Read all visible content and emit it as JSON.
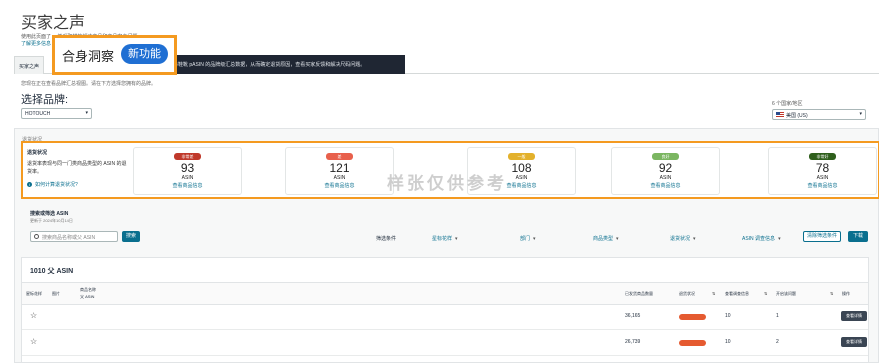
{
  "page": {
    "title": "买家之声"
  },
  "intro": {
    "line1": "使用此页面了                                                    ，并采取措施解决商品和商品客户问题。",
    "link": "了解更多信息"
  },
  "tabs": [
    {
      "label": "买家之声"
    },
    {
      "label": "合"
    }
  ],
  "feature": {
    "name": "合身洞察",
    "badge": "新功能"
  },
  "tooltip": {
    "text": "以查看服装与鞋靴 pASIN 的品牌级汇总数据，从而确定退货原因，查看买家反馈和解决尺码问题。"
  },
  "brand": {
    "note": "您现在正在查看品牌汇总视图。请在下方选择您拥有的品牌。",
    "label": "选择品牌:",
    "selected": "HOTOUCH"
  },
  "marketplace": {
    "label": "6 个国家/地区",
    "selected": "美国 (US)"
  },
  "ghost_row": "退货状况",
  "status_panel": {
    "heading": "退货状况",
    "text": "退货率表现与同一门类商品类型的 ASIN 的退货率。",
    "link": "如何计算退货状况?",
    "cards": [
      {
        "label": "非常差",
        "value": "93",
        "unit": "ASIN",
        "link": "查看商品信息",
        "color": "#c0392b"
      },
      {
        "label": "差",
        "value": "121",
        "unit": "ASIN",
        "link": "查看商品信息",
        "color": "#e8604c"
      },
      {
        "label": "一般",
        "value": "108",
        "unit": "ASIN",
        "link": "查看商品信息",
        "color": "#e3b12c"
      },
      {
        "label": "良好",
        "value": "92",
        "unit": "ASIN",
        "link": "查看商品信息",
        "color": "#7bb661"
      },
      {
        "label": "非常好",
        "value": "78",
        "unit": "ASIN",
        "link": "查看商品信息",
        "color": "#2f5f1c"
      }
    ]
  },
  "watermark": "样张仅供参考",
  "search": {
    "heading": "搜索或筛选 ASIN",
    "updated": "更新于 2024年10月14日",
    "placeholder": "搜索商品名称或父 ASIN",
    "button": "搜索"
  },
  "filters": {
    "label": "筛选条件",
    "items": [
      "星标花样",
      "部门",
      "商品类型",
      "退货状况",
      "ASIN 调查信息"
    ],
    "clear": "清除筛选条件",
    "download": "下载"
  },
  "table": {
    "title": "1010 父 ASIN",
    "headers": {
      "star": "星标花样",
      "image": "图片",
      "name": "商品名称",
      "parent": "父 ASIN",
      "orders": "已发货商品数量",
      "status": "退货状况",
      "reviews": "查看调查信息",
      "days": "开启该问题",
      "action": "操作"
    },
    "rows": [
      {
        "orders": "36,165",
        "reviews": "10",
        "days": "1",
        "action": "查看详情"
      },
      {
        "orders": "26,739",
        "reviews": "10",
        "days": "2",
        "action": "查看详情"
      }
    ]
  }
}
